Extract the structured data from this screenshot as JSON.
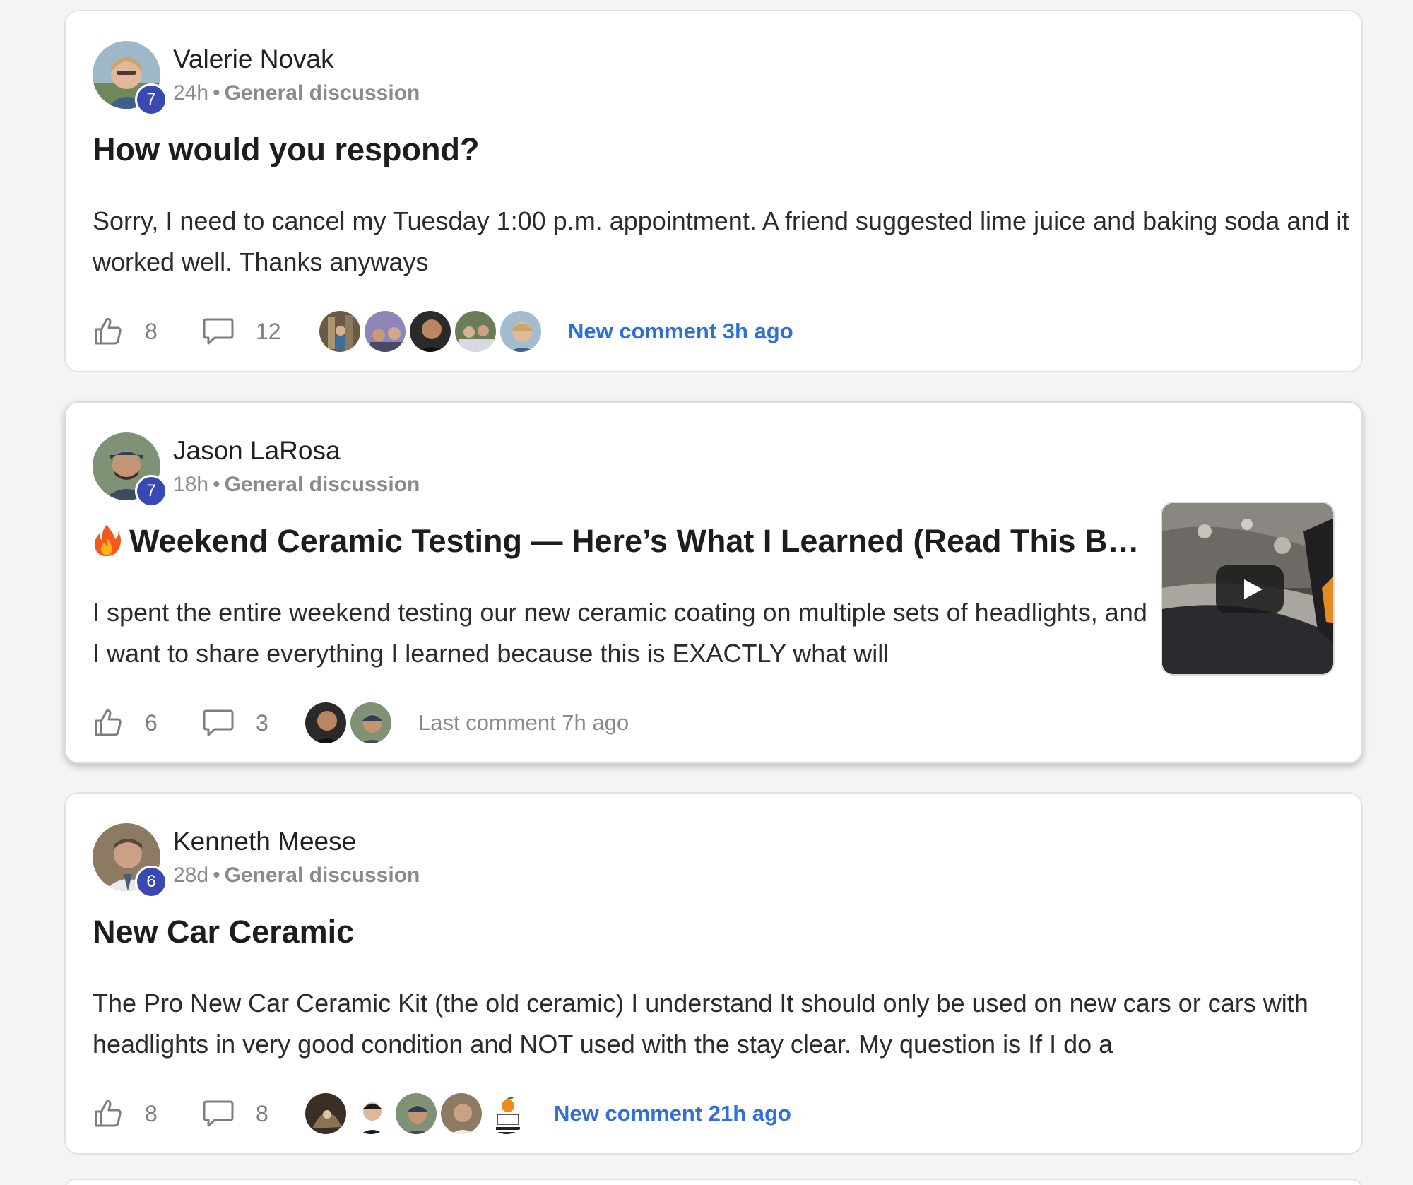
{
  "posts": [
    {
      "author": "Valerie Novak",
      "level": "7",
      "time": "24h",
      "separator": "•",
      "category": "General discussion",
      "title": "How would you respond?",
      "body": "Sorry, I need to cancel my Tuesday 1:00 p.m. appointment. A friend suggested lime juice and baking soda and it worked well. Thanks anyways",
      "likes": "8",
      "comments": "12",
      "activity": "New comment 3h ago"
    },
    {
      "author": "Jason LaRosa",
      "level": "7",
      "time": "18h",
      "separator": "•",
      "category": "General discussion",
      "title": "Weekend Ceramic Testing — Here’s What I Learned (Read This B…",
      "body": "I spent the entire weekend testing our new ceramic coating on multiple sets of headlights, and I want to share everything I learned because this is EXACTLY what will",
      "likes": "6",
      "comments": "3",
      "activity": "Last comment 7h ago",
      "emoji_icon": "fire-icon",
      "has_video": true
    },
    {
      "author": "Kenneth Meese",
      "level": "6",
      "time": "28d",
      "separator": "•",
      "category": "General discussion",
      "title": "New Car Ceramic",
      "body": "The Pro New Car Ceramic Kit (the old ceramic) I understand It should only be used on new cars or cars with headlights in very good condition and NOT used with the stay clear. My question is If I do a",
      "likes": "8",
      "comments": "8",
      "activity": "New comment 21h ago"
    }
  ],
  "colors": {
    "accent_link": "#2f6fdc",
    "level_badge": "#3948b3",
    "muted_text": "#8a8a8a",
    "background": "#f4f4f3"
  },
  "icons": {
    "like": "thumbs-up-icon",
    "comment": "speech-bubble-icon",
    "video": "play-icon"
  }
}
